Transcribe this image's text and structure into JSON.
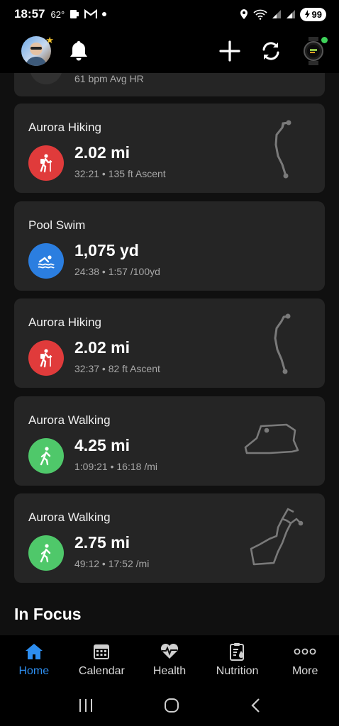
{
  "status_bar": {
    "time": "18:57",
    "temperature": "62°",
    "battery": "99",
    "icons": [
      "photo-icon",
      "cast-icon",
      "gmail-icon",
      "dot-icon",
      "location-icon",
      "wifi-icon",
      "signal-icon",
      "signal-icon",
      "battery-icon"
    ]
  },
  "header": {
    "icons": [
      "avatar",
      "bell-icon",
      "plus-icon",
      "sync-icon",
      "watch-icon"
    ],
    "watch_status_color": "#3ed35a"
  },
  "partial_card": {
    "text": "61 bpm Avg HR"
  },
  "activities": [
    {
      "title": "Aurora Hiking",
      "value": "2.02 mi",
      "sub": "32:21 • 135 ft Ascent",
      "icon": "hiking-icon",
      "color": "#e03b3b",
      "has_map": true
    },
    {
      "title": "Pool Swim",
      "value": "1,075 yd",
      "sub": "24:38 • 1:57 /100yd",
      "icon": "swim-icon",
      "color": "#2b7ee0",
      "has_map": false
    },
    {
      "title": "Aurora Hiking",
      "value": "2.02 mi",
      "sub": "32:37 • 82 ft Ascent",
      "icon": "hiking-icon",
      "color": "#e03b3b",
      "has_map": true
    },
    {
      "title": "Aurora Walking",
      "value": "4.25 mi",
      "sub": "1:09:21 • 16:18 /mi",
      "icon": "walking-icon",
      "color": "#4fc86a",
      "has_map": true
    },
    {
      "title": "Aurora Walking",
      "value": "2.75 mi",
      "sub": "49:12 • 17:52 /mi",
      "icon": "walking-icon",
      "color": "#4fc86a",
      "has_map": true
    }
  ],
  "section": {
    "title": "In Focus"
  },
  "bottom_nav": [
    {
      "label": "Home",
      "icon": "home-icon",
      "active": true
    },
    {
      "label": "Calendar",
      "icon": "calendar-icon",
      "active": false
    },
    {
      "label": "Health",
      "icon": "health-icon",
      "active": false
    },
    {
      "label": "Nutrition",
      "icon": "nutrition-icon",
      "active": false
    },
    {
      "label": "More",
      "icon": "more-icon",
      "active": false
    }
  ],
  "colors": {
    "accent": "#2d8ef0",
    "card_bg": "#252525",
    "background": "#101010"
  }
}
